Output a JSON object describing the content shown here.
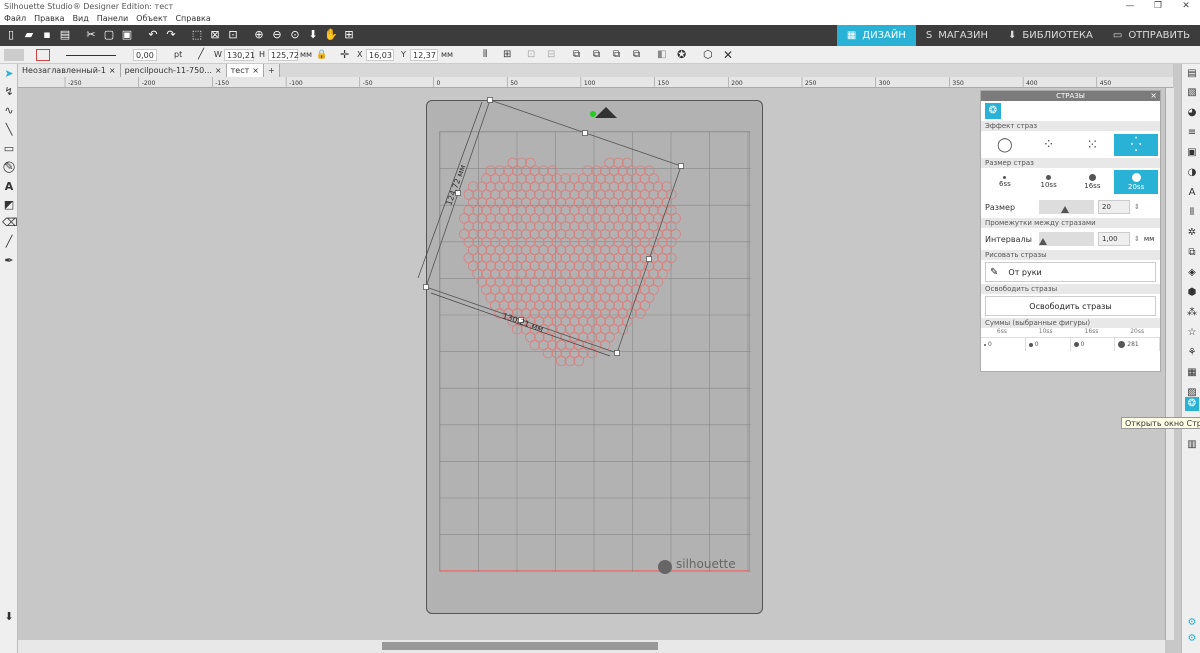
{
  "window": {
    "title": "Silhouette Studio® Designer Edition: тест",
    "minimize": "—",
    "maximize": "❐",
    "close": "✕"
  },
  "menu": [
    "Файл",
    "Правка",
    "Вид",
    "Панели",
    "Объект",
    "Справка"
  ],
  "mode_tabs": [
    {
      "label": "ДИЗАЙН",
      "icon": "grid-icon",
      "glyph": "▦"
    },
    {
      "label": "МАГАЗИН",
      "icon": "store-icon",
      "glyph": "S"
    },
    {
      "label": "БИБЛИОТЕКА",
      "icon": "library-icon",
      "glyph": "⬇"
    },
    {
      "label": "ОТПРАВИТЬ",
      "icon": "send-icon",
      "glyph": "▭"
    }
  ],
  "properties": {
    "line_width": "0,00",
    "line_unit": "pt",
    "w_label": "W",
    "w_value": "130,21",
    "h_label": "H",
    "h_value": "125,72",
    "size_unit": "мм",
    "x_label": "X",
    "x_value": "16,03",
    "y_label": "Y",
    "y_value": "12,37",
    "pos_unit": "мм"
  },
  "doc_tabs": [
    {
      "label": "Неозаглавленный-1",
      "close": "×"
    },
    {
      "label": "pencilpouch-11-750...",
      "close": "×"
    },
    {
      "label": "тест",
      "close": "×"
    }
  ],
  "add_tab": "+",
  "ruler_labels": [
    "-250",
    "-200",
    "-150",
    "-100",
    "-50",
    "0",
    "50",
    "100",
    "150",
    "200",
    "250",
    "300",
    "350",
    "400",
    "450"
  ],
  "canvas": {
    "dim_height": "124,72 мм",
    "dim_width": "130,21 мм",
    "brand": "silhouette",
    "colors": {
      "rhinestone": "#d98080",
      "cut_border": "#e57b7b",
      "accent": "#2ab2d6"
    }
  },
  "panel": {
    "title": "СТРАЗЫ",
    "effect_label": "Эффект страз",
    "size_section": "Размер страз",
    "sizes": [
      "6ss",
      "10ss",
      "16ss",
      "20ss"
    ],
    "size_label": "Размер",
    "size_value": "20",
    "spacing_section": "Промежутки между стразами",
    "spacing_label": "Интервалы",
    "spacing_value": "1,00",
    "spacing_unit": "мм",
    "draw_section": "Рисовать стразы",
    "draw_button": "От руки",
    "release_section": "Освободить стразы",
    "release_button": "Освободить стразы",
    "sums_section": "Суммы (выбранные фигуры)",
    "sum_headers": [
      "6ss",
      "10ss",
      "16ss",
      "20ss"
    ],
    "sum_values": [
      "0",
      "0",
      "0",
      "281"
    ]
  },
  "tooltip": "Открыть окно Стразы"
}
